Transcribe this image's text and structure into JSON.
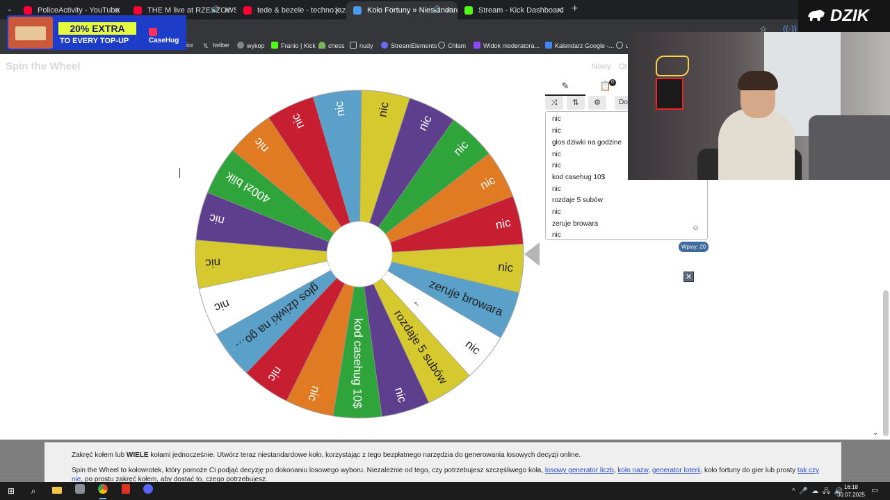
{
  "browser": {
    "tabs": [
      {
        "title": "PoliceActivity - YouTube",
        "favicon_color": "#ff0033",
        "active": false
      },
      {
        "title": "THE M live at RZESZOWSKI",
        "favicon_color": "#ff0033",
        "active": false
      },
      {
        "title": "tede & bezele - techno jazda ja",
        "favicon_color": "#ff0033",
        "active": false
      },
      {
        "title": "Koło Fortuny » Niestandard",
        "favicon_color": "#4a9be8",
        "active": true
      },
      {
        "title": "Stream - Kick Dashboard",
        "favicon_color": "#53fc18",
        "active": false
      }
    ],
    "bookmarks": [
      {
        "label": "ualior",
        "icon": "folder-icon"
      },
      {
        "label": "twitter",
        "icon": "x-icon"
      },
      {
        "label": "wykop",
        "icon": "wykop-icon"
      },
      {
        "label": "Franio | Kick",
        "icon": "kick-icon"
      },
      {
        "label": "chess",
        "icon": "pawn-icon"
      },
      {
        "label": "nudy",
        "icon": "folder-icon"
      },
      {
        "label": "StreamElements",
        "icon": "streamelements-icon"
      },
      {
        "label": "Chłam",
        "icon": "globe-icon"
      },
      {
        "label": "Widok moderatora...",
        "icon": "twitch-icon"
      },
      {
        "label": "Kalendarz Google -...",
        "icon": "calendar-icon"
      },
      {
        "label": "u",
        "icon": "globe-icon"
      }
    ]
  },
  "ad": {
    "title": "20% EXTRA",
    "subtitle": "TO EVERY TOP-UP",
    "brand": "CaseHug"
  },
  "overlay_logo": "DZIK",
  "page": {
    "logo": "Spin the Wheel",
    "nowy": "Nowy",
    "otworz": "Ot"
  },
  "wheel": {
    "segments": [
      {
        "label": "nic",
        "color": "#d6c92f"
      },
      {
        "label": "zeruje browara",
        "color": "#5aa0c8"
      },
      {
        "label": "nic",
        "color": "#ffffff"
      },
      {
        "label": "rozdaje 5 subów",
        "color": "#d6c92f"
      },
      {
        "label": "nic",
        "color": "#5e3f8e"
      },
      {
        "label": "kod casehug 10$",
        "color": "#2fa43a"
      },
      {
        "label": "nic",
        "color": "#e07b24"
      },
      {
        "label": "nic",
        "color": "#c81e32"
      },
      {
        "label": "głos dziwki na go…",
        "color": "#5aa0c8"
      },
      {
        "label": "nic",
        "color": "#ffffff"
      },
      {
        "label": "nic",
        "color": "#d6c92f"
      },
      {
        "label": "nic",
        "color": "#5e3f8e"
      },
      {
        "label": "400zł blik",
        "color": "#2fa43a"
      },
      {
        "label": "nic",
        "color": "#e07b24"
      },
      {
        "label": "nic",
        "color": "#c81e32"
      },
      {
        "label": "nic",
        "color": "#5aa0c8"
      },
      {
        "label": "nic",
        "color": "#d6c92f"
      },
      {
        "label": "nic",
        "color": "#5e3f8e"
      },
      {
        "label": "nic",
        "color": "#2fa43a"
      },
      {
        "label": "nic",
        "color": "#e07b24"
      },
      {
        "label": "nic",
        "color": "#c81e32"
      }
    ]
  },
  "panel": {
    "tab_edit_icon": "pencil-icon",
    "tab_results_icon": "clipboard-icon",
    "results_badge": "0",
    "tools": [
      "shuffle-icon",
      "sort-icon",
      "settings-icon"
    ],
    "doc_label": "Doc",
    "entries": [
      "nic",
      "nic",
      "głos dziwki na godzine",
      "nic",
      "nic",
      "kod casehug 10$",
      "nic",
      "rozdaje 5 subów",
      "nic",
      "zeruje browara",
      "nic"
    ],
    "entries_count": "Wpisy: 20"
  },
  "info": {
    "p1_before": "Zakręć kołem lub ",
    "p1_bold": "WIELE",
    "p1_after": " kołami jednocześnie. Utwórz teraz niestandardowe koło, korzystając z tego bezpłatnego narzędzia do generowania losowych decyzji online.",
    "p2_a": "Spin the Wheel to kołowrotek, który pomoże Ci podjąć decyzję po dokonaniu losowego wyboru. Niezależnie od tego, czy potrzebujesz szczęśliwego koła, ",
    "link1": "losowy generator liczb",
    "sep1": ", ",
    "link2": "koło nazw",
    "sep2": ", ",
    "link3": "generator loterii",
    "p2_b": ", koło fortuny do gier lub prosty ",
    "link4": "tak czy nie",
    "p2_c": ", po prostu zakręć kołem, aby dostać to, czego potrzebujesz."
  },
  "taskbar": {
    "time": "16:18",
    "date": "30.07.2025"
  },
  "colors": {
    "chrome_dark": "#1f2023",
    "chrome_mid": "#35363a",
    "link": "#2a4bd4",
    "count_badge": "#3f6a9c"
  }
}
